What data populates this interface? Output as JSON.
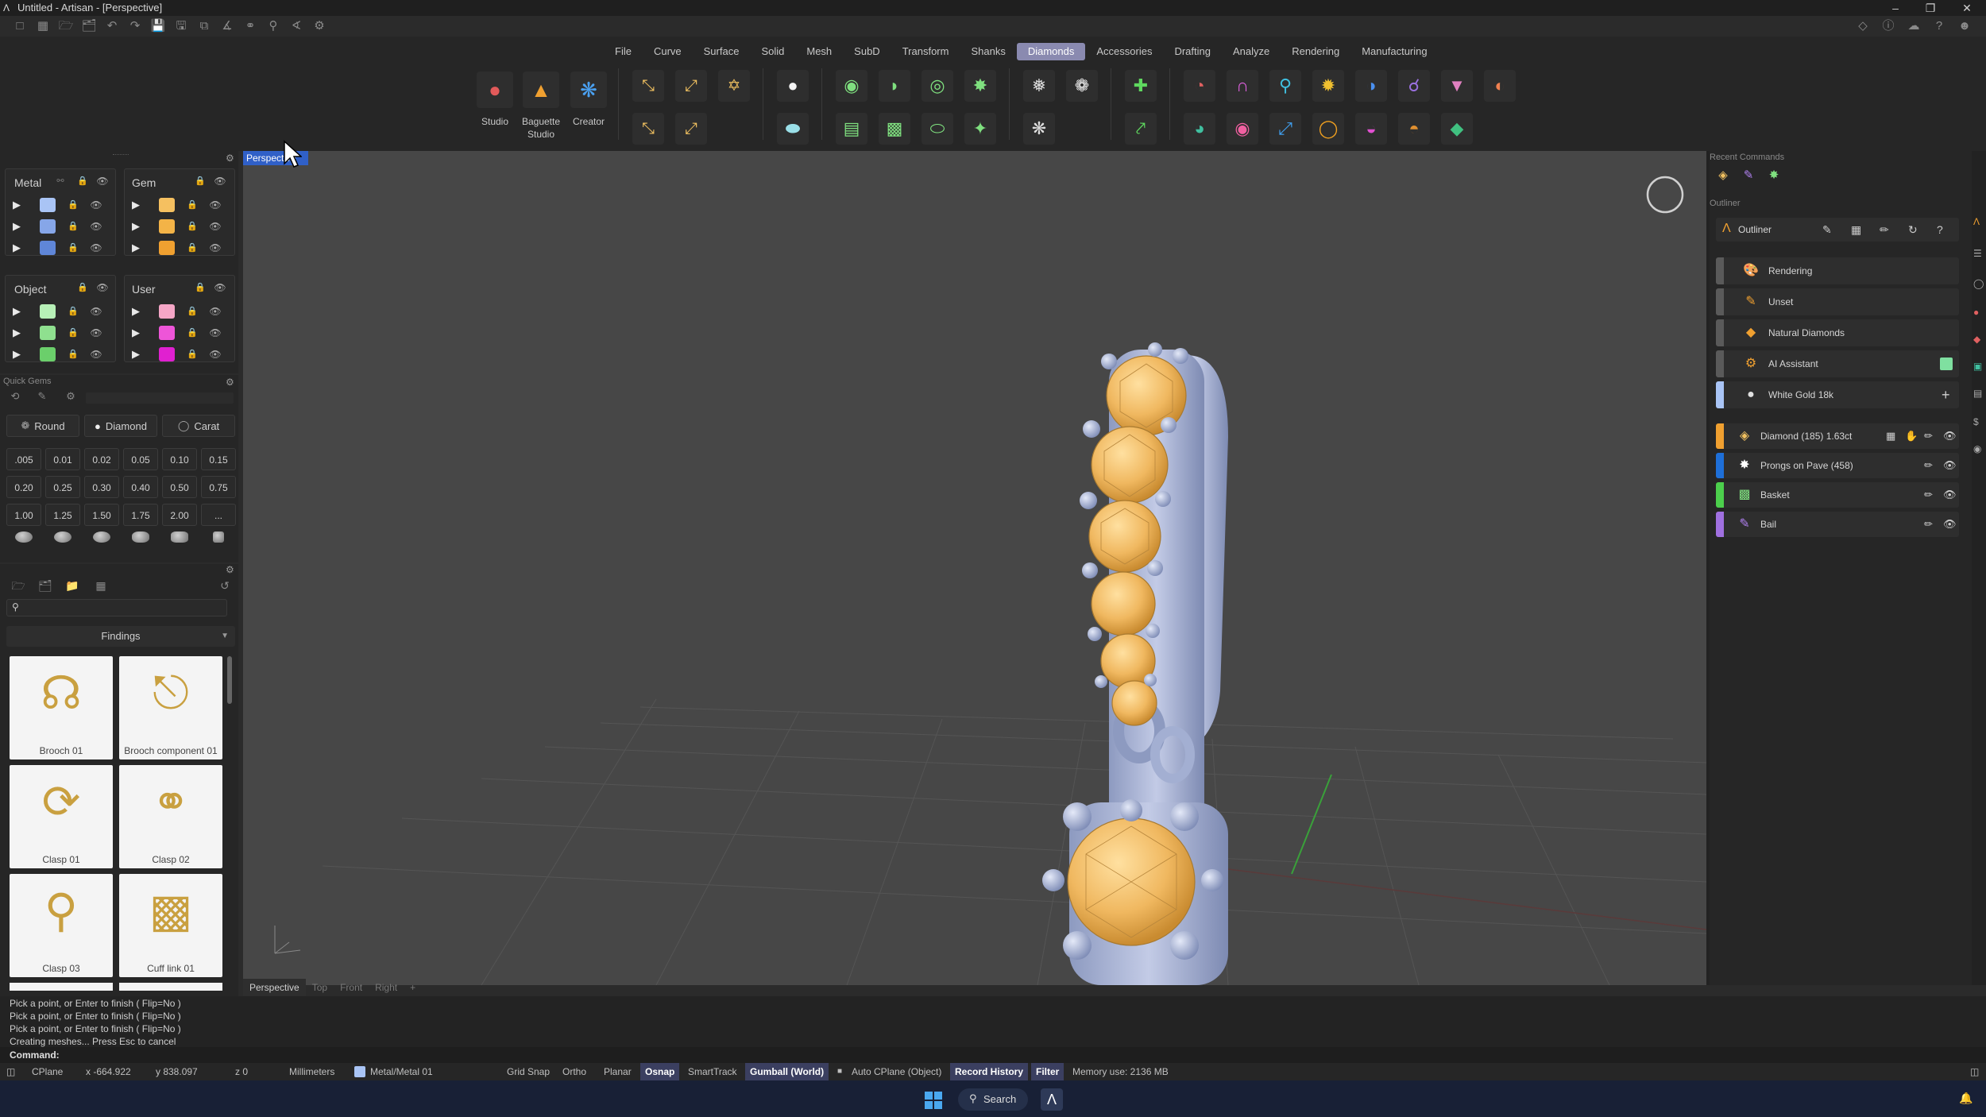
{
  "window": {
    "title": "Untitled - Artisan - [Perspective]",
    "controls": [
      "minimize",
      "restore",
      "close"
    ]
  },
  "menu": {
    "items": [
      {
        "label": "File",
        "active": false
      },
      {
        "label": "Curve",
        "active": false
      },
      {
        "label": "Surface",
        "active": false
      },
      {
        "label": "Solid",
        "active": false
      },
      {
        "label": "Mesh",
        "active": false
      },
      {
        "label": "SubD",
        "active": false
      },
      {
        "label": "Transform",
        "active": false
      },
      {
        "label": "Shanks",
        "active": false
      },
      {
        "label": "Diamonds",
        "active": true
      },
      {
        "label": "Accessories",
        "active": false
      },
      {
        "label": "Drafting",
        "active": false
      },
      {
        "label": "Analyze",
        "active": false
      },
      {
        "label": "Rendering",
        "active": false
      },
      {
        "label": "Manufacturing",
        "active": false
      }
    ]
  },
  "ribbon": {
    "studio_label": "Studio",
    "baguette_label_1": "Baguette",
    "baguette_label_2": "Studio",
    "creator_label": "Creator"
  },
  "layers": {
    "metal_title": "Metal",
    "gem_title": "Gem",
    "object_title": "Object",
    "user_title": "User",
    "metal_colors": [
      "#a9c4f5",
      "#86a6e8",
      "#5f86d8"
    ],
    "gem_colors": [
      "#f5c060",
      "#f3b347",
      "#f0a030"
    ],
    "object_colors": [
      "#b7f0b7",
      "#8fe08f",
      "#6bcf6b"
    ],
    "user_colors": [
      "#f5a6c6",
      "#ee55d8",
      "#e020d0"
    ]
  },
  "quick_gems": {
    "title": "Quick Gems",
    "shape": "Round",
    "material": "Diamond",
    "unit": "Carat",
    "sizes": [
      ".005",
      "0.01",
      "0.02",
      "0.05",
      "0.10",
      "0.15",
      "0.20",
      "0.25",
      "0.30",
      "0.40",
      "0.50",
      "0.75",
      "1.00",
      "1.25",
      "1.50",
      "1.75",
      "2.00",
      "..."
    ]
  },
  "library": {
    "search_placeholder": "",
    "category": "Findings",
    "items": [
      {
        "label": "Brooch 01"
      },
      {
        "label": "Brooch component 01"
      },
      {
        "label": "Clasp 01"
      },
      {
        "label": "Clasp 02"
      },
      {
        "label": "Clasp 03"
      },
      {
        "label": "Cuff link 01"
      }
    ]
  },
  "viewport": {
    "name": "Perspective",
    "tabs": [
      "Perspective",
      "Top",
      "Front",
      "Right",
      "+"
    ]
  },
  "recent_commands": {
    "title": "Recent Commands"
  },
  "outliner": {
    "section_title": "Outliner",
    "header_label": "Outliner",
    "materials": [
      {
        "label": "Rendering",
        "bar": "#5a5a5a",
        "icon": "palette-icon",
        "icon_color": "#f0a030"
      },
      {
        "label": "Unset",
        "bar": "#5a5a5a",
        "icon": "brush-icon",
        "icon_color": "#f0a030"
      },
      {
        "label": "Natural Diamonds",
        "bar": "#5a5a5a",
        "icon": "diamond-icon",
        "icon_color": "#f0a030"
      },
      {
        "label": "AI Assistant",
        "bar": "#5a5a5a",
        "icon": "assistant-icon",
        "icon_color": "#f0a030"
      },
      {
        "label": "White Gold 18k",
        "bar": "#a9c4f5",
        "icon": "metal-sphere-icon",
        "icon_color": "#e0e0e0"
      }
    ],
    "objects": [
      {
        "label": "Diamond (185) 1.63ct",
        "bar": "#f0a030"
      },
      {
        "label": "Prongs on Pave (458)",
        "bar": "#1e6fd8"
      },
      {
        "label": "Basket",
        "bar": "#4ccf4c"
      },
      {
        "label": "Bail",
        "bar": "#a070e0"
      }
    ]
  },
  "command": {
    "history": [
      "Pick a point, or Enter to finish ( Flip=No )",
      "Pick a point, or Enter to finish ( Flip=No )",
      "Pick a point, or Enter to finish ( Flip=No )",
      "Creating meshes... Press Esc to cancel"
    ],
    "prompt": "Command:"
  },
  "status": {
    "cplane": "CPlane",
    "x": "x -664.922",
    "y": "y 838.097",
    "z": "z 0",
    "units": "Millimeters",
    "layer": "Metal/Metal 01",
    "grid_snap": "Grid Snap",
    "ortho": "Ortho",
    "planar": "Planar",
    "osnap": "Osnap",
    "smarttrack": "SmartTrack",
    "gumball": "Gumball (World)",
    "auto_cplane": "Auto CPlane (Object)",
    "record_history": "Record History",
    "filter": "Filter",
    "memory": "Memory use: 2136 MB"
  },
  "taskbar": {
    "search_label": "Search"
  }
}
